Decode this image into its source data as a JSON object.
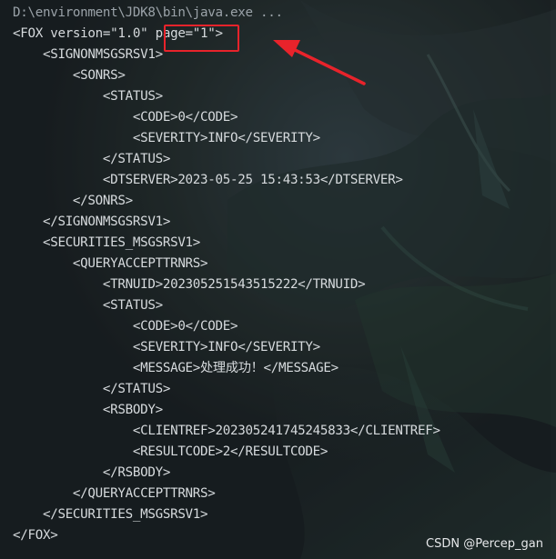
{
  "console": {
    "command_line": "D:\\environment\\JDK8\\bin\\java.exe ...",
    "lines": [
      "<FOX version=\"1.0\" page=\"1\">",
      "    <SIGNONMSGSRSV1>",
      "        <SONRS>",
      "            <STATUS>",
      "                <CODE>0</CODE>",
      "                <SEVERITY>INFO</SEVERITY>",
      "            </STATUS>",
      "            <DTSERVER>2023-05-25 15:43:53</DTSERVER>",
      "        </SONRS>",
      "    </SIGNONMSGSRSV1>",
      "    <SECURITIES_MSGSRSV1>",
      "        <QUERYACCEPTTRNRS>",
      "            <TRNUID>202305251543515222</TRNUID>",
      "            <STATUS>",
      "                <CODE>0</CODE>",
      "                <SEVERITY>INFO</SEVERITY>",
      "                <MESSAGE>处理成功！</MESSAGE>",
      "            </STATUS>",
      "            <RSBODY>",
      "                <CLIENTREF>202305241745245833</CLIENTREF>",
      "                <RESULTCODE>2</RESULTCODE>",
      "            </RSBODY>",
      "        </QUERYACCEPTTRNRS>",
      "    </SECURITIES_MSGSRSV1>",
      "</FOX>"
    ]
  },
  "annotation": {
    "box_color": "#e8232b",
    "arrow_color": "#e8232b"
  },
  "watermark": {
    "text": "CSDN @Percep_gan"
  },
  "colors": {
    "console_text": "#d6dadd",
    "background": "#1f2529"
  }
}
